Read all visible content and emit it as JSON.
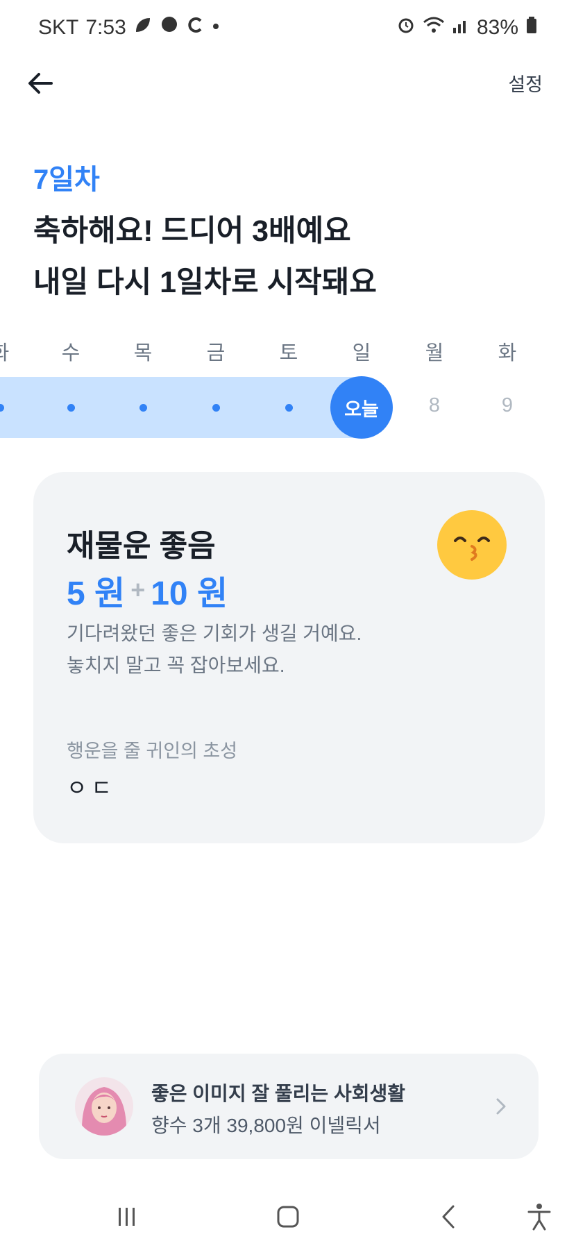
{
  "status_bar": {
    "carrier": "SKT",
    "time": "7:53",
    "battery": "83%"
  },
  "header": {
    "settings_label": "설정"
  },
  "streak": {
    "day_label": "7일차",
    "headline_line1": "축하해요! 드디어 3배예요",
    "headline_line2": "내일 다시 1일차로 시작돼요"
  },
  "week": {
    "days": [
      "화",
      "수",
      "목",
      "금",
      "토",
      "일",
      "월",
      "화"
    ],
    "today_label": "오늘",
    "future_dates": [
      "8",
      "9"
    ]
  },
  "fortune": {
    "title": "재물운 좋음",
    "base_reward": "5 원",
    "plus_sign": "+",
    "bonus_reward": "10 원",
    "desc_line1": "기다려왔던 좋은 기회가 생길 거예요.",
    "desc_line2": "놓치지 말고 꼭 잡아보세요.",
    "benefactor_label": "행운을 줄 귀인의 초성",
    "benefactor_initials": "ㅇㄷ",
    "emoji_icon": "kissing-face-icon"
  },
  "ad": {
    "title": "좋은 이미지 잘 풀리는 사회생활",
    "subtitle": "향수 3개 39,800원 이넬릭서"
  },
  "colors": {
    "accent": "#3182f6",
    "band": "#c9e2ff",
    "card": "#f2f4f6"
  }
}
